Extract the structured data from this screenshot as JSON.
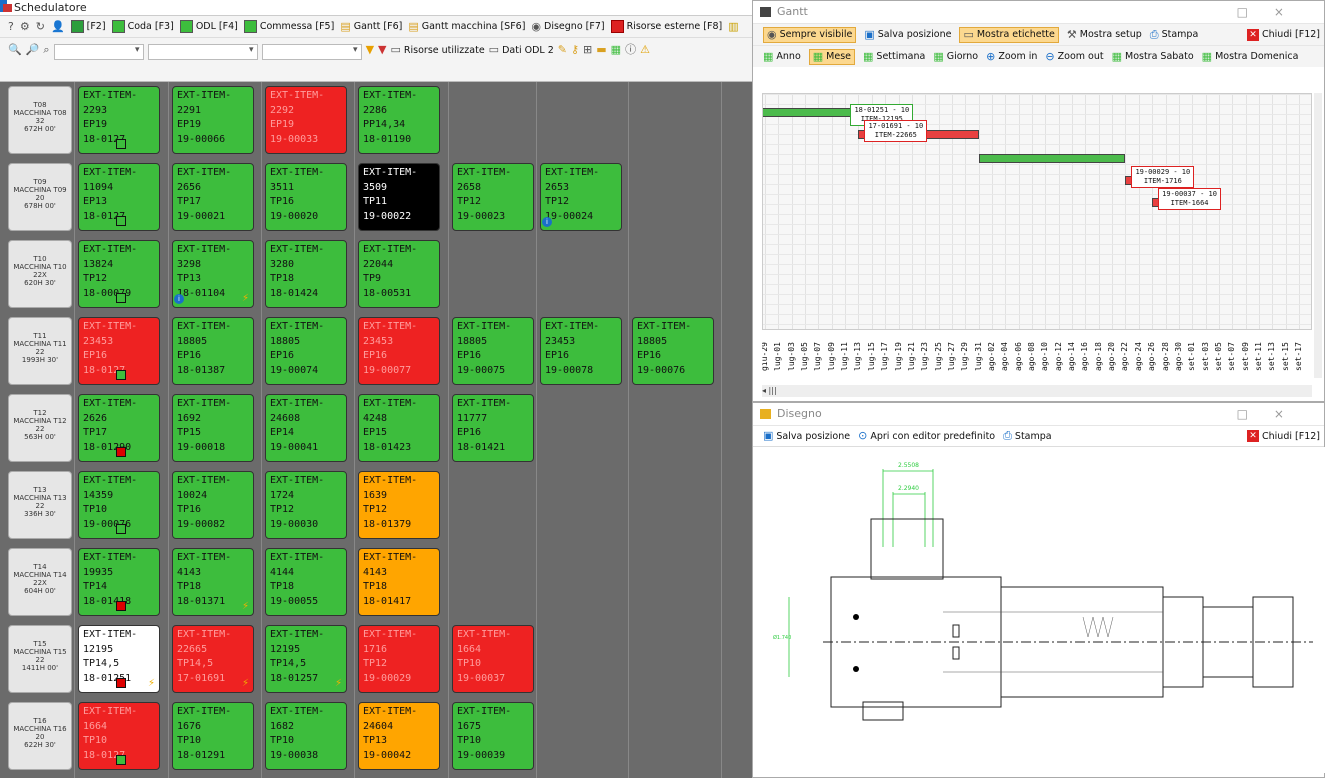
{
  "app": {
    "title": "Schedulatore"
  },
  "toolbar1": {
    "items": [
      {
        "key": "F2",
        "label": "[F2]"
      },
      {
        "key": "coda",
        "label": "Coda [F3]"
      },
      {
        "key": "odl",
        "label": "ODL [F4]"
      },
      {
        "key": "commessa",
        "label": "Commessa [F5]"
      },
      {
        "key": "gantt",
        "label": "Gantt [F6]"
      },
      {
        "key": "gantt-macchina",
        "label": "Gantt macchina [SF6]"
      },
      {
        "key": "disegno",
        "label": "Disegno [F7]"
      },
      {
        "key": "risorse-esterne",
        "label": "Risorse esterne [F8]"
      }
    ]
  },
  "toolbar2": {
    "risorse_utilizzate": "Risorse utilizzate",
    "dati_odl2": "Dati ODL 2"
  },
  "machines": [
    {
      "label": "T08\nMACCHINA T08\n32\n672H 00'",
      "cells": [
        {
          "c": "green",
          "t": "EXT-ITEM-\n2293\nEP19\n18-0127"
        },
        {
          "c": "green",
          "t": "EXT-ITEM-\n2291\nEP19\n19-00066"
        },
        {
          "c": "red",
          "t": "EXT-ITEM-\n2292\nEP19\n19-00033"
        },
        {
          "c": "green",
          "t": "EXT-ITEM-\n2286\nPP14,34\n18-01190"
        }
      ]
    },
    {
      "label": "T09\nMACCHINA T09\n20\n678H 00'",
      "cells": [
        {
          "c": "green",
          "t": "EXT-ITEM-\n11094\nEP13\n18-0127"
        },
        {
          "c": "green",
          "t": "EXT-ITEM-\n2656\nTP17\n19-00021"
        },
        {
          "c": "green",
          "t": "EXT-ITEM-\n3511\nTP16\n19-00020"
        },
        {
          "c": "black",
          "t": "EXT-ITEM-\n3509\nTP11\n19-00022"
        },
        {
          "c": "green",
          "t": "EXT-ITEM-\n2658\nTP12\n19-00023"
        },
        {
          "c": "green",
          "t": "EXT-ITEM-\n2653\nTP12\n19-00024"
        }
      ]
    },
    {
      "label": "T10\nMACCHINA T10\n22X\n620H 30'",
      "cells": [
        {
          "c": "green",
          "t": "EXT-ITEM-\n13824\nTP12\n18-00079"
        },
        {
          "c": "green",
          "t": "EXT-ITEM-\n3298\nTP13\n18-01104"
        },
        {
          "c": "green",
          "t": "EXT-ITEM-\n3280\nTP18\n18-01424"
        },
        {
          "c": "green",
          "t": "EXT-ITEM-\n22044\nTP9\n18-00531"
        }
      ]
    },
    {
      "label": "T11\nMACCHINA T11\n22\n1993H 30'",
      "cells": [
        {
          "c": "red",
          "t": "EXT-ITEM-\n23453\nEP16\n18-0127"
        },
        {
          "c": "green",
          "t": "EXT-ITEM-\n18805\nEP16\n18-01387"
        },
        {
          "c": "green",
          "t": "EXT-ITEM-\n18805\nEP16\n19-00074"
        },
        {
          "c": "red",
          "t": "EXT-ITEM-\n23453\nEP16\n19-00077"
        },
        {
          "c": "green",
          "t": "EXT-ITEM-\n18805\nEP16\n19-00075"
        },
        {
          "c": "green",
          "t": "EXT-ITEM-\n23453\nEP16\n19-00078"
        },
        {
          "c": "green",
          "t": "EXT-ITEM-\n18805\nEP16\n19-00076"
        }
      ]
    },
    {
      "label": "T12\nMACCHINA T12\n22\n563H 00'",
      "cells": [
        {
          "c": "green",
          "t": "EXT-ITEM-\n2626\nTP17\n18-01290"
        },
        {
          "c": "green",
          "t": "EXT-ITEM-\n1692\nTP15\n19-00018"
        },
        {
          "c": "green",
          "t": "EXT-ITEM-\n24608\nEP14\n19-00041"
        },
        {
          "c": "green",
          "t": "EXT-ITEM-\n4248\nEP15\n18-01423"
        },
        {
          "c": "green",
          "t": "EXT-ITEM-\n11777\nEP16\n18-01421"
        }
      ]
    },
    {
      "label": "T13\nMACCHINA T13\n22\n336H 30'",
      "cells": [
        {
          "c": "green",
          "t": "EXT-ITEM-\n14359\nTP10\n19-00076"
        },
        {
          "c": "green",
          "t": "EXT-ITEM-\n10024\nTP16\n19-00082"
        },
        {
          "c": "green",
          "t": "EXT-ITEM-\n1724\nTP12\n19-00030"
        },
        {
          "c": "orange",
          "t": "EXT-ITEM-\n1639\nTP12\n18-01379"
        }
      ]
    },
    {
      "label": "T14\nMACCHINA T14\n22X\n604H 00'",
      "cells": [
        {
          "c": "green",
          "t": "EXT-ITEM-\n19935\nTP14\n18-01418"
        },
        {
          "c": "green",
          "t": "EXT-ITEM-\n4143\nTP18\n18-01371"
        },
        {
          "c": "green",
          "t": "EXT-ITEM-\n4144\nTP18\n19-00055"
        },
        {
          "c": "orange",
          "t": "EXT-ITEM-\n4143\nTP18\n18-01417"
        }
      ]
    },
    {
      "label": "T15\nMACCHINA T15\n22\n1411H 00'",
      "cells": [
        {
          "c": "white",
          "t": "EXT-ITEM-\n12195\nTP14,5\n18-01251"
        },
        {
          "c": "red",
          "t": "EXT-ITEM-\n22665\nTP14,5\n17-01691"
        },
        {
          "c": "green",
          "t": "EXT-ITEM-\n12195\nTP14,5\n18-01257"
        },
        {
          "c": "red",
          "t": "EXT-ITEM-\n1716\nTP12\n19-00029"
        },
        {
          "c": "red",
          "t": "EXT-ITEM-\n1664\nTP10\n19-00037"
        }
      ]
    },
    {
      "label": "T16\nMACCHINA T16\n20\n622H 30'",
      "cells": [
        {
          "c": "red",
          "t": "EXT-ITEM-\n1664\nTP10\n18-0127"
        },
        {
          "c": "green",
          "t": "EXT-ITEM-\n1676\nTP10\n18-01291"
        },
        {
          "c": "green",
          "t": "EXT-ITEM-\n1682\nTP10\n19-00038"
        },
        {
          "c": "orange",
          "t": "EXT-ITEM-\n24604\nTP13\n19-00042"
        },
        {
          "c": "green",
          "t": "EXT-ITEM-\n1675\nTP10\n19-00039"
        }
      ]
    }
  ],
  "gantt": {
    "title": "Gantt",
    "bar1": {
      "sempre_visibile": "Sempre visibile",
      "salva_posizione": "Salva posizione",
      "mostra_etichette": "Mostra etichette",
      "mostra_setup": "Mostra setup",
      "stampa": "Stampa",
      "chiudi": "Chiudi [F12]"
    },
    "bar2": {
      "anno": "Anno",
      "mese": "Mese",
      "settimana": "Settimana",
      "giorno": "Giorno",
      "zoom_in": "Zoom in",
      "zoom_out": "Zoom out",
      "mostra_sabato": "Mostra Sabato",
      "mostra_domenica": "Mostra Domenica"
    },
    "bars": [
      {
        "label": "18-01251 - 10\nITEM-12195",
        "color": "#4cbb4c",
        "start": "gio-29",
        "end": "lug-13"
      },
      {
        "label": "17-01691 - 10\nITEM-22665",
        "color": "#e84040",
        "start": "lug-13",
        "end": "lug-31"
      },
      {
        "label": "",
        "color": "#4cbb4c",
        "start": "lug-31",
        "end": "ago-22"
      },
      {
        "label": "19-00029 - 10\nITEM-1716",
        "color": "#e84040",
        "start": "ago-22",
        "end": "ago-26"
      },
      {
        "label": "19-00037 - 10\nITEM-1664",
        "color": "#e84040",
        "start": "ago-26",
        "end": "set-05"
      }
    ],
    "ticks": [
      "giu-29",
      "lug-01",
      "lug-03",
      "lug-05",
      "lug-07",
      "lug-09",
      "lug-11",
      "lug-13",
      "lug-15",
      "lug-17",
      "lug-19",
      "lug-21",
      "lug-23",
      "lug-25",
      "lug-27",
      "lug-29",
      "lug-31",
      "ago-02",
      "ago-04",
      "ago-06",
      "ago-08",
      "ago-10",
      "ago-12",
      "ago-14",
      "ago-16",
      "ago-18",
      "ago-20",
      "ago-22",
      "ago-24",
      "ago-26",
      "ago-28",
      "ago-30",
      "set-01",
      "set-03",
      "set-05",
      "set-07",
      "set-09",
      "set-11",
      "set-13",
      "set-15",
      "set-17"
    ]
  },
  "disegno": {
    "title": "Disegno",
    "salva_posizione": "Salva posizione",
    "apri_editor": "Apri con editor predefinito",
    "stampa": "Stampa",
    "chiudi": "Chiudi [F12]",
    "dim1": "2.5508",
    "dim2": "2.2940",
    "dim3": "Ø1.740"
  },
  "colors": {
    "green": "#3dbd3d",
    "red": "#ee2222",
    "orange": "#ffa500",
    "accent": "#1a6fc9"
  }
}
